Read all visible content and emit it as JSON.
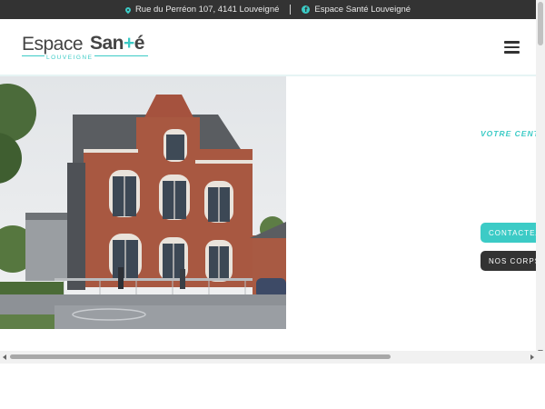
{
  "topbar": {
    "address": "Rue du Perréon 107,  4141 Louveigné",
    "facebook": "Espace Santé Louveigné",
    "icons": {
      "address": "map-pin-icon",
      "facebook": "facebook-icon"
    }
  },
  "logo": {
    "word1": "Espace",
    "word2_start": "San",
    "word2_plus": "+",
    "word2_end": "é",
    "subtitle": "LOUVEIGNE"
  },
  "menu": {
    "icon": "hamburger-menu-icon"
  },
  "hero": {
    "tagline": "VOTRE CENTRE",
    "buttons": {
      "contact": "CONTACTEZ-NOUS",
      "corps": "NOS CORPS MÉTIERS"
    }
  },
  "colors": {
    "accent": "#3ccbc6",
    "topbar": "#333333",
    "text": "#444444"
  }
}
